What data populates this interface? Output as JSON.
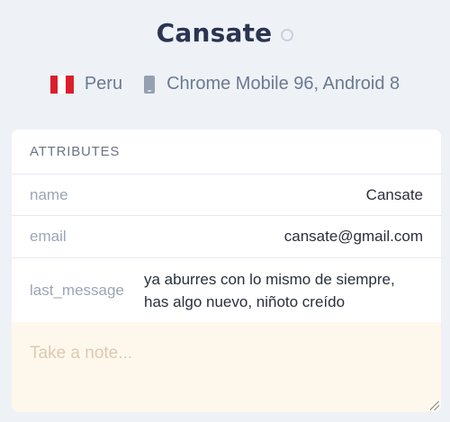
{
  "contact": {
    "name": "Cansate",
    "status": "offline"
  },
  "meta": {
    "country": "Peru",
    "country_flag": "peru-flag",
    "device": "Chrome Mobile 96, Android 8",
    "device_icon": "mobile-phone-icon"
  },
  "attributes": {
    "title": "ATTRIBUTES",
    "rows": [
      {
        "key": "name",
        "value": "Cansate"
      },
      {
        "key": "email",
        "value": "cansate@gmail.com"
      },
      {
        "key": "last_message",
        "value": "ya aburres con lo mismo de siempre, has algo nuevo, niñoto creído"
      }
    ]
  },
  "note": {
    "placeholder": "Take a note...",
    "value": ""
  },
  "colors": {
    "background": "#eef2f7",
    "title_text": "#2b3450",
    "note_background": "#fef8ec",
    "flag_red": "#d91f2b"
  }
}
